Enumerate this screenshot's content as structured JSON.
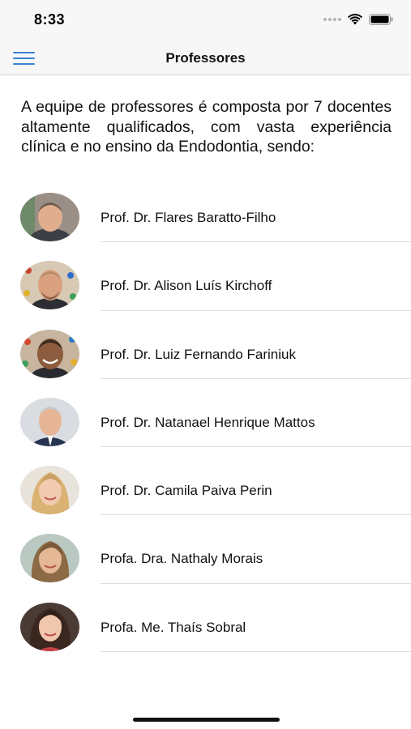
{
  "status_bar": {
    "time": "8:33"
  },
  "nav": {
    "title": "Professores"
  },
  "intro": "A equipe de professores é composta por 7 docentes altamente qualificados, com vasta experiência clínica e no ensino da Endodontia, sendo:",
  "professors": [
    {
      "name": "Prof. Dr. Flares Baratto-Filho",
      "photo_icon": "portrait-man-1"
    },
    {
      "name": "Prof. Dr. Alison Luís Kirchoff",
      "photo_icon": "portrait-man-2"
    },
    {
      "name": "Prof. Dr. Luiz Fernando Fariniuk",
      "photo_icon": "portrait-man-3"
    },
    {
      "name": "Prof. Dr. Natanael Henrique Mattos",
      "photo_icon": "portrait-man-4"
    },
    {
      "name": "Prof. Dr. Camila Paiva Perin",
      "photo_icon": "portrait-woman-1"
    },
    {
      "name": "Profa. Dra. Nathaly Morais",
      "photo_icon": "portrait-woman-2"
    },
    {
      "name": "Profa. Me. Thaís Sobral",
      "photo_icon": "portrait-woman-3"
    }
  ],
  "colors": {
    "accent": "#3b82d6",
    "nav_bg": "#f7f7f7",
    "divider": "#dcdcdc"
  }
}
